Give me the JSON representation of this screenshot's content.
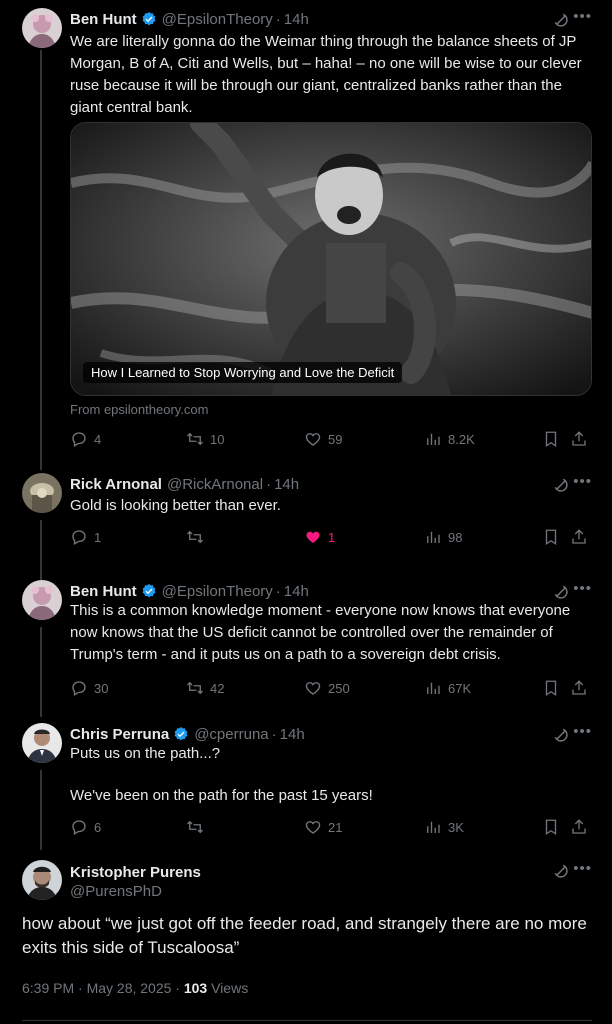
{
  "colors": {
    "accent": "#1d9bf0",
    "like": "#f91880",
    "muted": "#71767b",
    "text": "#e7e9ea"
  },
  "tweets": [
    {
      "name": "Ben Hunt",
      "handle": "@EpsilonTheory",
      "time": "14h",
      "text": "We are literally gonna do the Weimar thing through the balance sheets of JP Morgan, B of A, Citi and Wells, but – haha! – no one will be wise to our clever ruse because it will be through our giant, centralized banks rather than the giant central bank.",
      "card_title": "How I Learned to Stop Worrying and Love the Deficit",
      "card_from": "From epsilontheory.com",
      "replies": "4",
      "retweets": "10",
      "likes": "59",
      "views": "8.2K"
    },
    {
      "name": "Rick Arnonal",
      "handle": "@RickArnonal",
      "time": "14h",
      "text": "Gold is looking better than ever.",
      "replies": "1",
      "retweets": "",
      "likes": "1",
      "views": "98"
    },
    {
      "name": "Ben Hunt",
      "handle": "@EpsilonTheory",
      "time": "14h",
      "text": "This is a common knowledge moment - everyone now knows that everyone now knows that the US deficit cannot be controlled over the remainder of Trump's term - and it puts us on a path to a sovereign debt crisis.",
      "replies": "30",
      "retweets": "42",
      "likes": "250",
      "views": "67K"
    },
    {
      "name": "Chris Perruna",
      "handle": "@cperruna",
      "time": "14h",
      "text_line1": "Puts us on the path...?",
      "text_line2": "We've been on the path for the past 15 years!",
      "replies": "6",
      "retweets": "",
      "likes": "21",
      "views": "3K"
    }
  ],
  "main_tweet": {
    "name": "Kristopher Purens",
    "handle": "@PurensPhD",
    "text": "how about “we just got off the feeder road,  and strangely there are no more exits this side of Tuscaloosa”",
    "timestamp": "6:39 PM · May 28, 2025 · ",
    "views_count": "103",
    "views_label": " Views"
  },
  "icons": [
    "verified-icon",
    "grok-icon",
    "more-icon",
    "reply-icon",
    "retweet-icon",
    "like-icon",
    "views-icon",
    "bookmark-icon",
    "share-icon"
  ]
}
